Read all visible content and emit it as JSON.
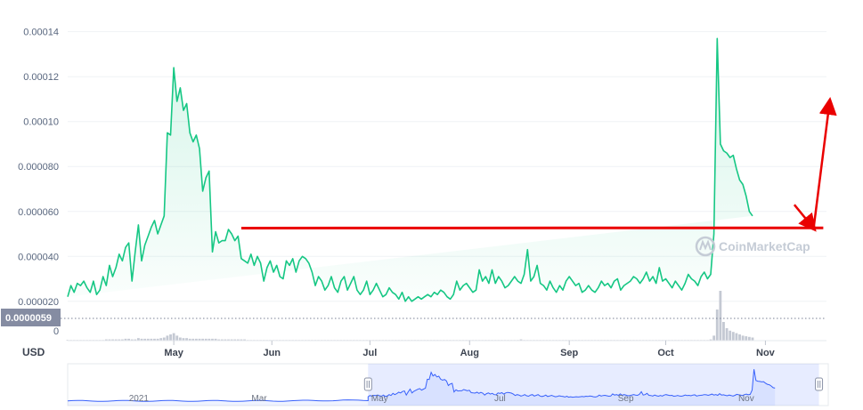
{
  "chart_data": {
    "type": "area",
    "currency_label": "USD",
    "watermark": "CoinMarketCap",
    "y_ticks": [
      "0.000020",
      "0.000040",
      "0.000060",
      "0.000080",
      "0.00010",
      "0.00012",
      "0.00014"
    ],
    "y_tick_values": [
      2e-05,
      4e-05,
      6e-05,
      8e-05,
      0.0001,
      0.00012,
      0.00014
    ],
    "ylim": [
      2.5e-06,
      0.000147
    ],
    "x_ticks": [
      "May",
      "Jun",
      "Jul",
      "Aug",
      "Sep",
      "Oct",
      "Nov"
    ],
    "x_tick_positions": [
      33,
      63.5,
      94,
      125,
      156,
      186,
      217
    ],
    "xlim": [
      0,
      236
    ],
    "grid": true,
    "colors": {
      "line": "#16c784",
      "fill": "#16c784",
      "annotation": "#ea0000",
      "badge": "#858ca2",
      "navigator": "#3861fb"
    },
    "current_price_badge": "0.0000059",
    "volume_zero_label": "0",
    "x": [
      0,
      1,
      2,
      3,
      4,
      5,
      6,
      7,
      8,
      9,
      10,
      11,
      12,
      13,
      14,
      15,
      16,
      17,
      18,
      19,
      20,
      21,
      22,
      23,
      24,
      25,
      26,
      27,
      28,
      29,
      30,
      31,
      32,
      33,
      34,
      35,
      36,
      37,
      38,
      39,
      40,
      41,
      42,
      43,
      44,
      45,
      46,
      47,
      48,
      49,
      50,
      51,
      52,
      53,
      54,
      55,
      56,
      57,
      58,
      59,
      60,
      61,
      62,
      63,
      64,
      65,
      66,
      67,
      68,
      69,
      70,
      71,
      72,
      73,
      74,
      75,
      76,
      77,
      78,
      79,
      80,
      81,
      82,
      83,
      84,
      85,
      86,
      87,
      88,
      89,
      90,
      91,
      92,
      93,
      94,
      95,
      96,
      97,
      98,
      99,
      100,
      101,
      102,
      103,
      104,
      105,
      106,
      107,
      108,
      109,
      110,
      111,
      112,
      113,
      114,
      115,
      116,
      117,
      118,
      119,
      120,
      121,
      122,
      123,
      124,
      125,
      126,
      127,
      128,
      129,
      130,
      131,
      132,
      133,
      134,
      135,
      136,
      137,
      138,
      139,
      140,
      141,
      142,
      143,
      144,
      145,
      146,
      147,
      148,
      149,
      150,
      151,
      152,
      153,
      154,
      155,
      156,
      157,
      158,
      159,
      160,
      161,
      162,
      163,
      164,
      165,
      166,
      167,
      168,
      169,
      170,
      171,
      172,
      173,
      174,
      175,
      176,
      177,
      178,
      179,
      180,
      181,
      182,
      183,
      184,
      185,
      186,
      187,
      188,
      189,
      190,
      191,
      192,
      193,
      194,
      195,
      196,
      197,
      198,
      199,
      200,
      201,
      202,
      203,
      204,
      205,
      206,
      207,
      208,
      209,
      210,
      211,
      212,
      213,
      214,
      215,
      216,
      217,
      218,
      219,
      220,
      221,
      222,
      223,
      224,
      225,
      226,
      227,
      228,
      229,
      230,
      231,
      232,
      233,
      234,
      235,
      236
    ],
    "values": [
      2.2e-05,
      2.7e-05,
      2.4e-05,
      2.8e-05,
      2.7e-05,
      2.9e-05,
      2.6e-05,
      2.4e-05,
      2.9e-05,
      2.3e-05,
      2.5e-05,
      3.1e-05,
      2.7e-05,
      3.6e-05,
      3.1e-05,
      3.5e-05,
      4.1e-05,
      3.8e-05,
      4.4e-05,
      4.6e-05,
      2.9e-05,
      4.2e-05,
      5.4e-05,
      3.8e-05,
      4.5e-05,
      4.9e-05,
      5.3e-05,
      5.6e-05,
      5e-05,
      5.4e-05,
      5.8e-05,
      9.5e-05,
      9.4e-05,
      0.000124,
      0.000109,
      0.000115,
      0.000105,
      0.000108,
      9.5e-05,
      9.1e-05,
      9.4e-05,
      8.8e-05,
      6.9e-05,
      7.5e-05,
      7.8e-05,
      4.2e-05,
      5.1e-05,
      4.6e-05,
      4.7e-05,
      4.7e-05,
      5.2e-05,
      5e-05,
      4.7e-05,
      4.9e-05,
      3.9e-05,
      3.8e-05,
      3.7e-05,
      4.1e-05,
      3.6e-05,
      4e-05,
      3.7e-05,
      2.9e-05,
      3.5e-05,
      3.8e-05,
      3.3e-05,
      3.6e-05,
      3.1e-05,
      3e-05,
      3.8e-05,
      3.6e-05,
      3.9e-05,
      3.3e-05,
      3.8e-05,
      4e-05,
      3.9e-05,
      3.7e-05,
      3.3e-05,
      2.7e-05,
      3.1e-05,
      2.9e-05,
      2.5e-05,
      2.7e-05,
      3.1e-05,
      2.6e-05,
      2.4e-05,
      2.9e-05,
      3.1e-05,
      2.5e-05,
      2.8e-05,
      3.1e-05,
      2.5e-05,
      2.3e-05,
      2.5e-05,
      2.9e-05,
      2.3e-05,
      2.5e-05,
      2.8e-05,
      2.5e-05,
      2.2e-05,
      2.3e-05,
      2.6e-05,
      2.4e-05,
      2.3e-05,
      2.1e-05,
      2.4e-05,
      2e-05,
      2.2e-05,
      2e-05,
      2.1e-05,
      2.2e-05,
      2.1e-05,
      2.2e-05,
      2.3e-05,
      2.2e-05,
      2.4e-05,
      2.3e-05,
      2.5e-05,
      2.4e-05,
      2.2e-05,
      2.1e-05,
      2.3e-05,
      2.9e-05,
      2.5e-05,
      2.7e-05,
      2.8e-05,
      2.6e-05,
      2.4e-05,
      2.5e-05,
      3.4e-05,
      2.9e-05,
      3.1e-05,
      2.8e-05,
      3.4e-05,
      2.8e-05,
      3.1e-05,
      2.9e-05,
      2.6e-05,
      2.7e-05,
      2.9e-05,
      3.1e-05,
      2.9e-05,
      2.8e-05,
      3.2e-05,
      4.3e-05,
      2.9e-05,
      3.1e-05,
      3.6e-05,
      2.8e-05,
      2.7e-05,
      2.5e-05,
      2.9e-05,
      2.6e-05,
      2.4e-05,
      2.7e-05,
      2.5e-05,
      2.9e-05,
      3.1e-05,
      2.9e-05,
      2.7e-05,
      2.8e-05,
      2.4e-05,
      2.5e-05,
      2.7e-05,
      2.5e-05,
      2.4e-05,
      2.6e-05,
      2.9e-05,
      2.7e-05,
      2.8e-05,
      2.6e-05,
      2.9e-05,
      3e-05,
      2.5e-05,
      2.7e-05,
      2.8e-05,
      2.9e-05,
      3.1e-05,
      3e-05,
      2.8e-05,
      3e-05,
      3.3e-05,
      2.9e-05,
      3.1e-05,
      2.8e-05,
      3.5e-05,
      2.9e-05,
      3e-05,
      2.8e-05,
      2.6e-05,
      2.9e-05,
      2.7e-05,
      2.5e-05,
      2.8e-05,
      3.2e-05,
      3e-05,
      2.9e-05,
      2.7e-05,
      3.1e-05,
      3.3e-05,
      3e-05,
      3.2e-05,
      5e-05,
      0.000137,
      9e-05,
      8.7e-05,
      8.6e-05,
      8.4e-05,
      8.5e-05,
      7.9e-05,
      7.4e-05,
      7.2e-05,
      6.7e-05,
      6e-05,
      5.8e-05
    ],
    "volume": [
      0.1,
      0.1,
      0.1,
      0.1,
      0.1,
      0.1,
      0.1,
      0.1,
      0.1,
      0.1,
      0.1,
      0.1,
      0.2,
      0.2,
      0.2,
      0.2,
      0.2,
      0.2,
      0.3,
      0.3,
      0.2,
      0.2,
      0.4,
      0.3,
      0.3,
      0.3,
      0.3,
      0.3,
      0.3,
      0.4,
      0.5,
      0.8,
      1.0,
      1.2,
      0.8,
      0.5,
      0.4,
      0.4,
      0.3,
      0.3,
      0.3,
      0.3,
      0.3,
      0.3,
      0.3,
      0.3,
      0.3,
      0.2,
      0.2,
      0.2,
      0.2,
      0.2,
      0.2,
      0.2,
      0.2,
      0.2,
      0.1,
      0.1,
      0.1,
      0.1,
      0.1,
      0.1,
      0.1,
      0.1,
      0.1,
      0.1,
      0.1,
      0.1,
      0.1,
      0.1,
      0.1,
      0.1,
      0.1,
      0.1,
      0.1,
      0.1,
      0.1,
      0.1,
      0.1,
      0.1,
      0.1,
      0.1,
      0.1,
      0.1,
      0.1,
      0.1,
      0.1,
      0.1,
      0.1,
      0.1,
      0.1,
      0.1,
      0.1,
      0.1,
      0.1,
      0.1,
      0.1,
      0.1,
      0.1,
      0.1,
      0.1,
      0.1,
      0.1,
      0.1,
      0.1,
      0.1,
      0.1,
      0.1,
      0.1,
      0.1,
      0.1,
      0.1,
      0.1,
      0.1,
      0.1,
      0.1,
      0.1,
      0.1,
      0.1,
      0.1,
      0.1,
      0.1,
      0.1,
      0.1,
      0.1,
      0.1,
      0.1,
      0.1,
      0.1,
      0.1,
      0.1,
      0.1,
      0.1,
      0.1,
      0.1,
      0.1,
      0.1,
      0.1,
      0.1,
      0.1,
      0.1,
      0.2,
      0.1,
      0.1,
      0.1,
      0.1,
      0.1,
      0.1,
      0.1,
      0.1,
      0.1,
      0.1,
      0.1,
      0.1,
      0.1,
      0.1,
      0.1,
      0.1,
      0.1,
      0.1,
      0.1,
      0.1,
      0.1,
      0.1,
      0.1,
      0.1,
      0.1,
      0.1,
      0.1,
      0.1,
      0.1,
      0.1,
      0.1,
      0.1,
      0.1,
      0.1,
      0.1,
      0.1,
      0.1,
      0.1,
      0.1,
      0.1,
      0.1,
      0.1,
      0.1,
      0.1,
      0.1,
      0.1,
      0.1,
      0.1,
      0.1,
      0.1,
      0.1,
      0.1,
      0.1,
      0.1,
      0.1,
      0.1,
      0.1,
      0.1,
      0.2,
      0.8,
      5.0,
      8.0,
      3.0,
      2.0,
      1.6,
      1.4,
      1.2,
      1.0,
      0.8,
      0.7,
      0.6,
      0.5
    ],
    "resistance_line": {
      "x": [
        54,
        235
      ],
      "y": [
        5.26e-05,
        5.27e-05
      ]
    },
    "annotation_arrow": {
      "x": [
        226,
        232,
        237
      ],
      "y": [
        6.3e-05,
        5.25e-05,
        0.000109
      ]
    },
    "navigator": {
      "labels": [
        "2021",
        "Mar",
        "May",
        "Jul",
        "Sep",
        "Nov"
      ],
      "label_positions": [
        0.13,
        0.35,
        0.57,
        0.79,
        1.02,
        1.24
      ],
      "selected_range": [
        0.549,
        1.373
      ]
    }
  }
}
